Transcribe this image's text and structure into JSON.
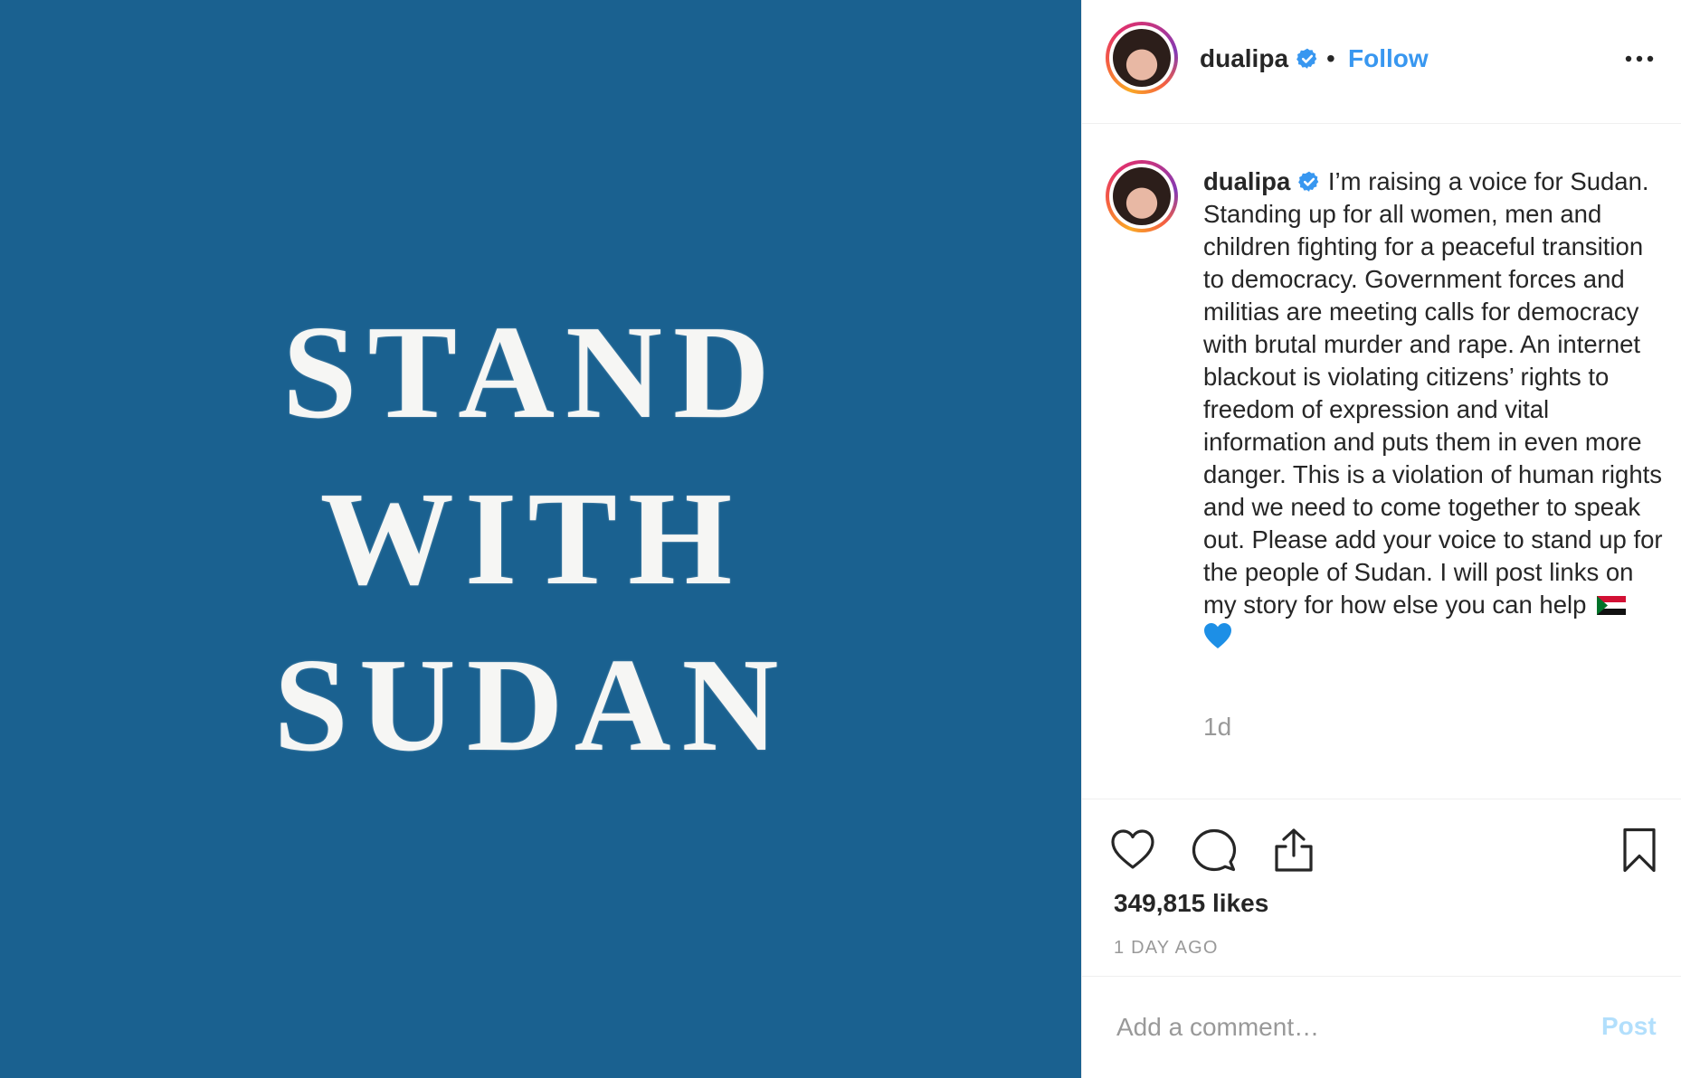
{
  "media": {
    "lines": [
      "STAND",
      "WITH",
      "SUDAN"
    ],
    "background_color": "#1a6190",
    "text_color": "#f6f6f4"
  },
  "header": {
    "username": "dualipa",
    "separator": "•",
    "follow_label": "Follow",
    "verified_icon": "verified-badge-icon",
    "more_icon": "more-options-icon"
  },
  "caption": {
    "username": "dualipa",
    "text": "I’m raising a voice for Sudan. Standing up for all women, men and children fighting for a peaceful transition to democracy. Government forces and militias are meeting calls for democracy with brutal murder and rape. An internet blackout is violating citizens’ rights to freedom of expression and vital information and puts them in even more danger. This is a violation of human rights and we need to come together to speak out. Please add your voice to stand up for the people of Sudan. I will post links on my story for how else you can help",
    "emoji_flag": "sudan-flag-icon",
    "emoji_heart": "💙",
    "time_ago": "1d"
  },
  "actions": {
    "like_icon": "heart-icon",
    "comment_icon": "comment-icon",
    "share_icon": "share-icon",
    "save_icon": "bookmark-icon"
  },
  "stats": {
    "likes": "349,815 likes",
    "date": "1 DAY AGO"
  },
  "comment_bar": {
    "placeholder": "Add a comment…",
    "post_label": "Post"
  },
  "colors": {
    "accent": "#3897f0",
    "post_disabled": "#b2dffc",
    "muted": "#999999",
    "text": "#262626",
    "border": "#efefef"
  }
}
